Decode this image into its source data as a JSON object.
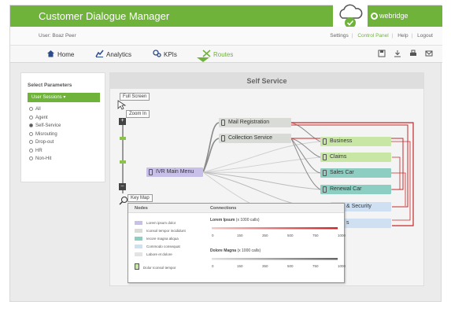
{
  "app": {
    "title": "Customer Dialogue Manager",
    "brand": "webridge",
    "user_line": "User: Boaz Peer"
  },
  "top_links": [
    "Settings",
    "Control Panel",
    "Help",
    "Logout"
  ],
  "top_links_active": "Control Panel",
  "nav": {
    "items": [
      {
        "label": "Home",
        "icon": "home-icon"
      },
      {
        "label": "Analytics",
        "icon": "analytics-icon"
      },
      {
        "label": "KPIs",
        "icon": "kpis-icon"
      },
      {
        "label": "Routes",
        "icon": "routes-icon"
      }
    ],
    "active": "Routes",
    "tools": [
      "save-icon",
      "download-icon",
      "print-icon",
      "mail-icon"
    ]
  },
  "params": {
    "title": "Select Parameters",
    "selected": "User Sessions",
    "options": [
      "All",
      "Agent",
      "Self-Service",
      "Misrouting",
      "Drop-out",
      "HR",
      "Non-Hit"
    ],
    "checked": "Self-Service"
  },
  "main": {
    "title": "Self Service",
    "full_screen": "Full Screen",
    "zoom_in": "Zoom In",
    "key_map": "Key Map",
    "zoom_plus": "+",
    "zoom_minus": "–"
  },
  "nodes": {
    "root": "IVR Main Menu",
    "mid": [
      "Mail Registration",
      "Collection Service"
    ],
    "right": [
      "Business",
      "Claims",
      "Sales Car",
      "Renewal Car",
      "& Security",
      "s"
    ]
  },
  "legend": {
    "nodes_header": "Nodes",
    "connections_header": "Connections",
    "items": [
      "Lorem ipsum dolor",
      "Iconsol tempor incididunt",
      "Iecore magna aliqua",
      "Commodo consequat",
      "Labore et dolore"
    ],
    "icon_item": "Dolor Iconsol tempor",
    "conn_blocks": [
      {
        "title": "Lorem Ipsum",
        "unit": "(x 1000 calls)",
        "ticks": [
          "0",
          "150",
          "350",
          "500",
          "750",
          "1000"
        ]
      },
      {
        "title": "Dolore Magna",
        "unit": "(x 1000 calls)",
        "ticks": [
          "0",
          "150",
          "350",
          "500",
          "750",
          "1000"
        ]
      }
    ]
  },
  "colors": {
    "brand_green": "#6fb33b",
    "route_red": "#c62828",
    "route_gray": "#8a8a8a"
  }
}
